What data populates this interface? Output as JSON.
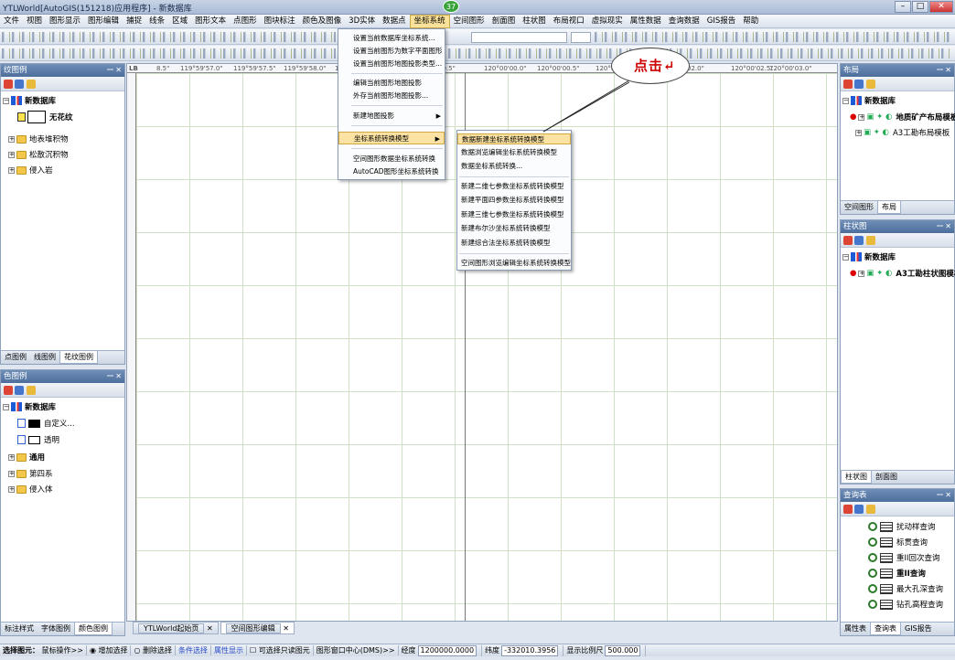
{
  "window": {
    "title": "YTLWorld[AutoGIS(151218)应用程序] - 新数据库",
    "badge": "37"
  },
  "menu": [
    "文件",
    "视图",
    "图形显示",
    "图形编辑",
    "捕捉",
    "线条",
    "区域",
    "图形文本",
    "点图形",
    "图块标注",
    "颜色及图像",
    "3D实体",
    "数据点",
    "坐标系统",
    "空间图形",
    "剖面图",
    "柱状图",
    "布局视口",
    "虚拟现实",
    "属性数据",
    "查询数据",
    "GIS报告",
    "帮助"
  ],
  "menu_active": "坐标系统",
  "coord_menu": {
    "items": [
      "设置当前数据库坐标系统...",
      "设置当前图形为数字平面图形",
      "设置当前图形地图投影类型...",
      "编辑当前图形地图投影",
      "外存当前图形地图投影...",
      "新建地图投影",
      "坐标系统转换模型",
      "空间图形数据坐标系统转换",
      "AutoCAD图形坐标系统转换"
    ],
    "highlight": "坐标系统转换模型"
  },
  "submenu": {
    "items": [
      "数据新建坐标系统转换模型",
      "数据浏览编辑坐标系统转换模型",
      "数据坐标系统转换...",
      "新建二维七参数坐标系统转换模型",
      "新建平面四参数坐标系统转换模型",
      "新建三维七参数坐标系统转换模型",
      "新建布尔沙坐标系统转换模型",
      "新建综合法坐标系统转换模型",
      "空间图形浏览编辑坐标系统转换模型"
    ],
    "highlight": "数据新建坐标系统转换模型"
  },
  "callout": "点击↵",
  "left_top_panel": {
    "title": "纹图例",
    "db": "新数据库",
    "items": [
      "无花纹",
      "地表堆积物",
      "松散沉积物",
      "侵入岩"
    ],
    "tabs": [
      "点图例",
      "线图例",
      "花纹图例"
    ]
  },
  "left_bottom_panel": {
    "title": "色图例",
    "db": "新数据库",
    "items": [
      "自定义...",
      "透明",
      "通用",
      "第四系",
      "侵入体"
    ],
    "tabs": [
      "标注样式",
      "字体图例",
      "颜色图例"
    ]
  },
  "right_layout": {
    "title": "布局",
    "db": "新数据库",
    "items": [
      "地质矿产布局模板",
      "A3工勘布局模板"
    ],
    "tabs": [
      "空间图形",
      "布局"
    ]
  },
  "right_column": {
    "title": "柱状图",
    "db": "新数据库",
    "items": [
      "A3工勘柱状图模板"
    ],
    "tabs": [
      "柱状图",
      "剖面图"
    ]
  },
  "right_query": {
    "title": "查询表",
    "items": [
      "扰动样查询",
      "标贯查询",
      "重II回次查询",
      "重II查询",
      "最大孔深查询",
      "钻孔高程查询"
    ],
    "tabs": [
      "属性表",
      "查询表",
      "GIS报告"
    ]
  },
  "ruler": {
    "top": [
      "8.5\"",
      "119°59'57.0\"",
      "119°59'57.5\"",
      "119°59'58.0\"",
      "119°59'58.5\"",
      "59.5\"",
      "120°00'00.0\"",
      "120°00'00.5\"",
      "120°00'01.0\"",
      "02.0\"",
      "120°00'02.5\"",
      "120°00'03.0\""
    ],
    "lb": "LB"
  },
  "doctabs": [
    "YTLWorld起始页",
    "空间图形编辑"
  ],
  "status": {
    "label": "选择图元：",
    "op": "鼠标操作>>",
    "add": "增加选择",
    "del": "删除选择",
    "cond": "条件选择",
    "attr": "属性显示",
    "readonly": "可选择只读图元",
    "center": "图形窗口中心(DMS)>>",
    "lon_l": "经度",
    "lon": "1200000.0000",
    "lat_l": "纬度",
    "lat": "-332010.3956",
    "scale_l": "显示比例尺",
    "scale": "500.000"
  }
}
